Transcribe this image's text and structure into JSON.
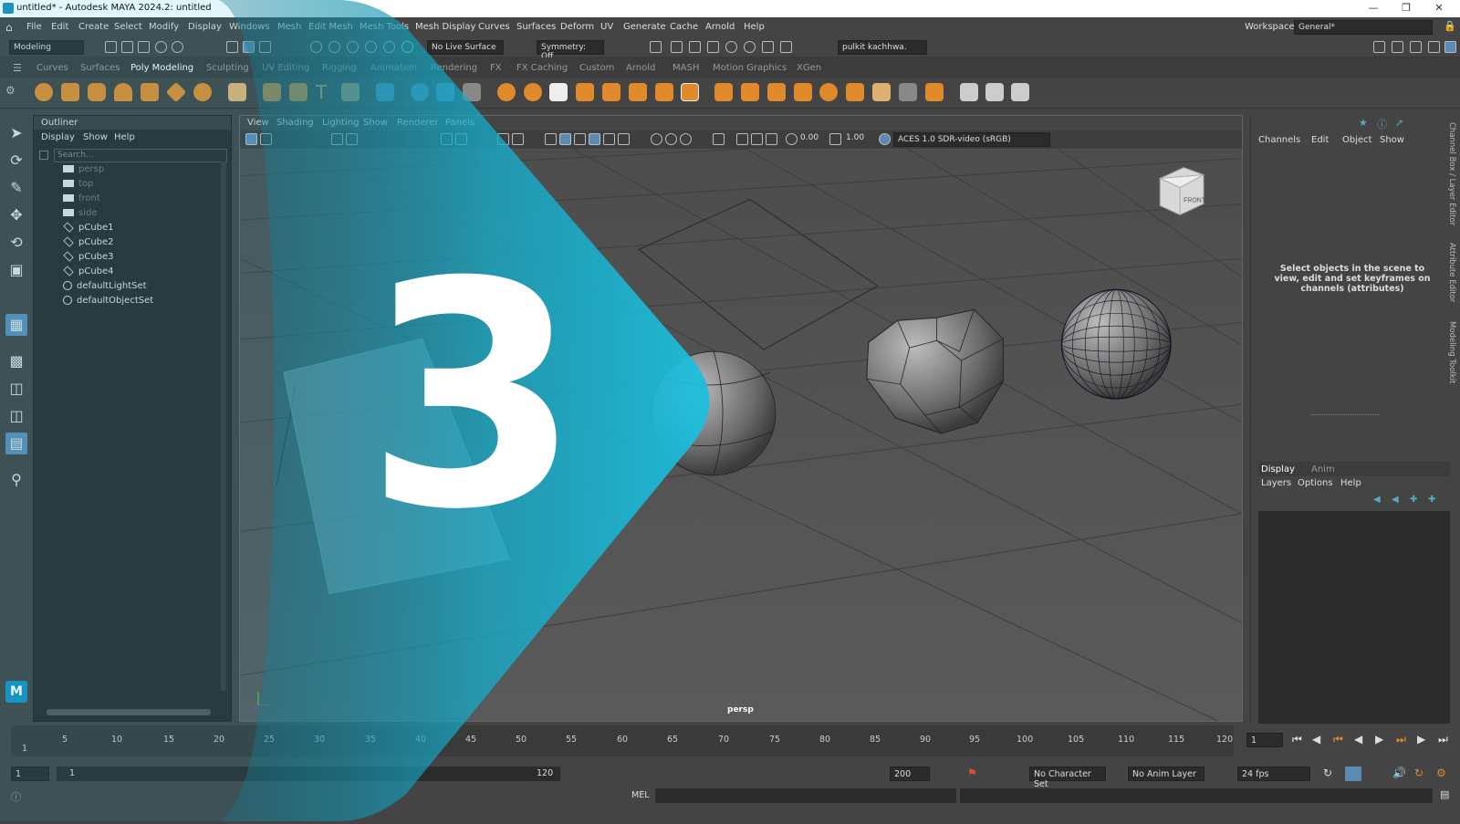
{
  "window": {
    "title": "untitled* - Autodesk MAYA 2024.2: untitled"
  },
  "menus": [
    "File",
    "Edit",
    "Create",
    "Select",
    "Modify",
    "Display",
    "Windows",
    "Mesh",
    "Edit Mesh",
    "Mesh Tools",
    "Mesh Display",
    "Curves",
    "Surfaces",
    "Deform",
    "UV",
    "Generate",
    "Cache",
    "Arnold",
    "Help"
  ],
  "workspace": {
    "label": "Workspace:",
    "value": "General*"
  },
  "toolbar": {
    "mode": "Modeling",
    "live_surface": "No Live Surface",
    "symmetry": "Symmetry: Off",
    "user": "pulkit kachhwa."
  },
  "shelf_tabs": [
    "Curves",
    "Surfaces",
    "Poly Modeling",
    "Sculpting",
    "UV Editing",
    "Rigging",
    "Animation",
    "Rendering",
    "FX",
    "FX Caching",
    "Custom",
    "Arnold",
    "MASH",
    "Motion Graphics",
    "XGen"
  ],
  "shelf_active": "Poly Modeling",
  "outliner": {
    "title": "Outliner",
    "menus": [
      "Display",
      "Show",
      "Help"
    ],
    "search_placeholder": "Search...",
    "items": [
      {
        "label": "persp",
        "icon": "camera-icon",
        "dim": true
      },
      {
        "label": "top",
        "icon": "camera-icon",
        "dim": true
      },
      {
        "label": "front",
        "icon": "camera-icon",
        "dim": true
      },
      {
        "label": "side",
        "icon": "camera-icon",
        "dim": true
      },
      {
        "label": "pCube1",
        "icon": "mesh-icon",
        "dim": false
      },
      {
        "label": "pCube2",
        "icon": "mesh-icon",
        "dim": false
      },
      {
        "label": "pCube3",
        "icon": "mesh-icon",
        "dim": false
      },
      {
        "label": "pCube4",
        "icon": "mesh-icon",
        "dim": false
      },
      {
        "label": "defaultLightSet",
        "icon": "set-icon",
        "dim": false
      },
      {
        "label": "defaultObjectSet",
        "icon": "set-icon",
        "dim": false
      }
    ]
  },
  "viewport": {
    "menus": [
      "View",
      "Shading",
      "Lighting",
      "Show",
      "Renderer",
      "Panels"
    ],
    "near_value": "0.00",
    "exposure_value": "1.00",
    "color_space": "ACES 1.0 SDR-video (sRGB)",
    "camera": "persp",
    "viewcube_label": "FRONT"
  },
  "channel_box": {
    "menus": [
      "Channels",
      "Edit",
      "Object",
      "Show"
    ],
    "message": "Select objects in the scene to view, edit and set keyframes on channels (attributes)",
    "layer_tabs": [
      "Display",
      "Anim"
    ],
    "layer_menus": [
      "Layers",
      "Options",
      "Help"
    ]
  },
  "side_tabs": [
    "Channel Box / Layer Editor",
    "Attribute Editor",
    "Modeling Toolkit"
  ],
  "timeline": {
    "ticks": [
      "5",
      "10",
      "15",
      "20",
      "25",
      "30",
      "35",
      "40",
      "45",
      "50",
      "55",
      "60",
      "65",
      "70",
      "75",
      "80",
      "85",
      "90",
      "95",
      "100",
      "105",
      "110",
      "115",
      "120"
    ],
    "start_label": "1",
    "current_frame": "1"
  },
  "range": {
    "start": "1",
    "range_start": "1",
    "range_end": "120",
    "end": "200",
    "character_set": "No Character Set",
    "anim_layer": "No Anim Layer",
    "fps": "24 fps"
  },
  "command": {
    "label": "MEL"
  },
  "overlay": {
    "number": "3",
    "accent": "#1bb5d4"
  }
}
